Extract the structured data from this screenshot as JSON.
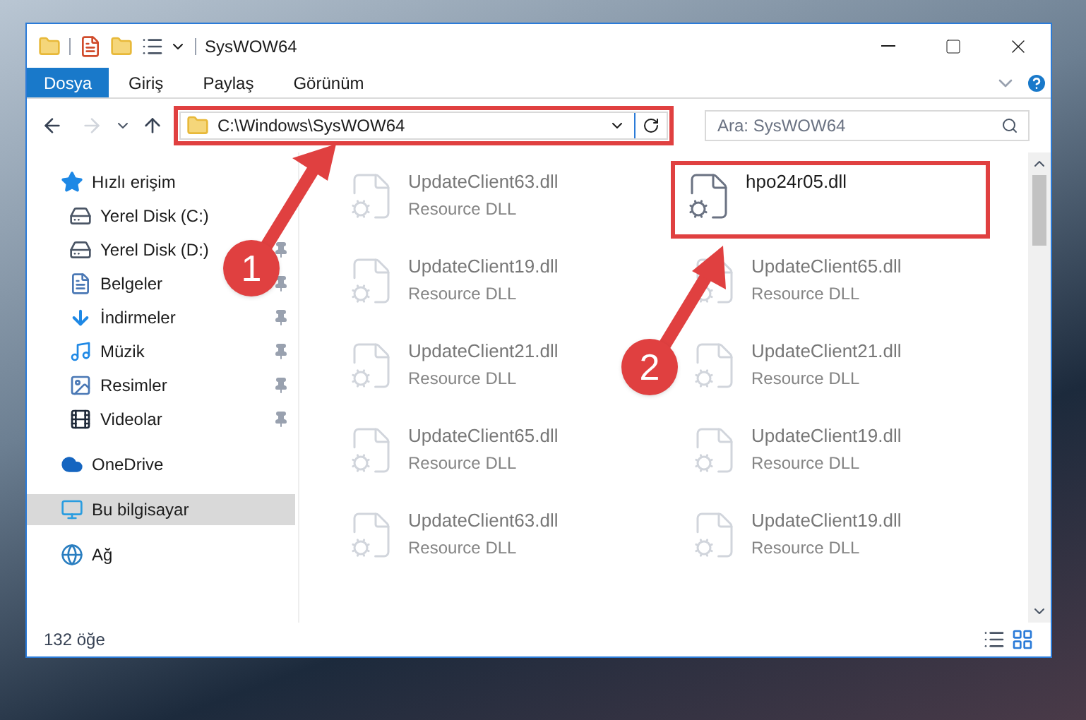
{
  "window": {
    "title": "SysWOW64"
  },
  "ribbon_tabs": [
    {
      "label": "Dosya",
      "selected": true
    },
    {
      "label": "Giriş",
      "selected": false
    },
    {
      "label": "Paylaş",
      "selected": false
    },
    {
      "label": "Görünüm",
      "selected": false
    }
  ],
  "address": {
    "path": "C:\\Windows\\SysWOW64",
    "highlighted": true
  },
  "search": {
    "placeholder": "Ara: SysWOW64"
  },
  "sidebar": {
    "items": [
      {
        "label": "Hızlı erişim",
        "kind": "quick",
        "pinned": false,
        "selected": false
      },
      {
        "label": "Yerel Disk (C:)",
        "kind": "drive",
        "pinned": false,
        "selected": false
      },
      {
        "label": "Yerel Disk (D:)",
        "kind": "drive",
        "pinned": true,
        "selected": false
      },
      {
        "label": "Belgeler",
        "kind": "docs",
        "pinned": true,
        "selected": false
      },
      {
        "label": "İndirmeler",
        "kind": "downloads",
        "pinned": true,
        "selected": false
      },
      {
        "label": "Müzik",
        "kind": "music",
        "pinned": true,
        "selected": false
      },
      {
        "label": "Resimler",
        "kind": "pictures",
        "pinned": true,
        "selected": false
      },
      {
        "label": "Videolar",
        "kind": "videos",
        "pinned": true,
        "selected": false
      },
      {
        "label": "OneDrive",
        "kind": "cloud",
        "pinned": false,
        "selected": false
      },
      {
        "label": "Bu bilgisayar",
        "kind": "pc",
        "pinned": false,
        "selected": true
      },
      {
        "label": "Ağ",
        "kind": "network",
        "pinned": false,
        "selected": false
      }
    ]
  },
  "files": [
    {
      "name": "UpdateClient63.dll",
      "type": "Resource DLL",
      "blurred": true
    },
    {
      "name": "hpo24r05.dll",
      "blurred": false,
      "highlighted": true
    },
    {
      "name": "UpdateClient19.dll",
      "type": "Resource DLL",
      "blurred": true
    },
    {
      "name": "UpdateClient65.dll",
      "type": "Resource DLL",
      "blurred": true
    },
    {
      "name": "UpdateClient21.dll",
      "type": "Resource DLL",
      "blurred": true
    },
    {
      "name": "UpdateClient21.dll",
      "type": "Resource DLL",
      "blurred": true
    },
    {
      "name": "UpdateClient65.dll",
      "type": "Resource DLL",
      "blurred": true
    },
    {
      "name": "UpdateClient19.dll",
      "type": "Resource DLL",
      "blurred": true
    },
    {
      "name": "UpdateClient63.dll",
      "type": "Resource DLL",
      "blurred": true
    },
    {
      "name": "UpdateClient19.dll",
      "type": "Resource DLL",
      "blurred": true
    }
  ],
  "status_bar": {
    "count": "132 öğe"
  },
  "annotations": [
    {
      "label": "1"
    },
    {
      "label": "2"
    }
  ]
}
